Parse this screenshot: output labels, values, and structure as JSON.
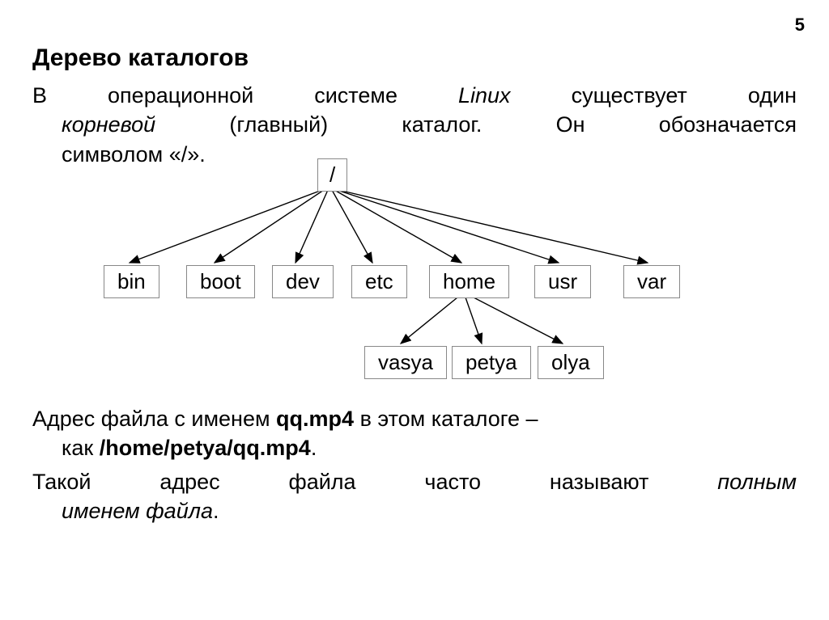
{
  "page_number": "5",
  "title": "Дерево каталогов",
  "intro": {
    "l1_a": "В операционной системе ",
    "l1_b": "Linux",
    "l1_c": " существует один",
    "l2_a": "корневой",
    "l2_b": " (главный) каталог. Он обозначается",
    "l3": "символом «/»."
  },
  "tree": {
    "root": "/",
    "level1": [
      "bin",
      "boot",
      "dev",
      "etc",
      "home",
      "usr",
      "var"
    ],
    "level2": [
      "vasya",
      "petya",
      "olya"
    ]
  },
  "para1": {
    "l1_a": "Адрес файла с именем ",
    "l1_b": "qq.mp4",
    "l1_c": " в этом каталоге –",
    "l2_a": "как ",
    "l2_b": "/home/petya/qq.mp4",
    "l2_c": "."
  },
  "para2": {
    "l1": "Такой адрес файла часто называют ",
    "l1_i": "полным",
    "l2_i": "именем файла",
    "l2": "."
  }
}
